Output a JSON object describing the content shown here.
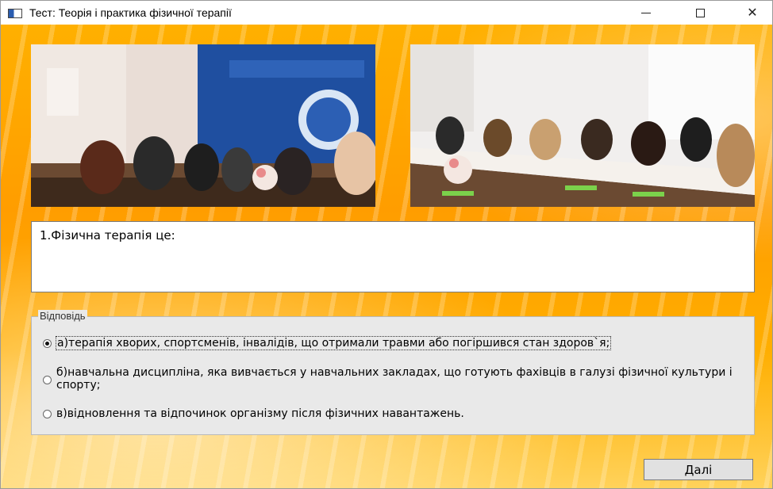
{
  "window": {
    "title": "Тест: Теорія і практика фізичної терапії",
    "minimize_glyph": "—",
    "maximize_glyph": "☐",
    "close_glyph": "✕"
  },
  "question": {
    "text": "1.Фізична терапія це:"
  },
  "answers": {
    "legend": "Відповідь",
    "options": [
      {
        "label": "а)терапія хворих, спортсменів, інвалідів, що отримали травми або погіршився стан здоров`я;",
        "selected": true
      },
      {
        "label": "б)навчальна дисципліна, яка вивчається у навчальних закладах, що готують фахівців в галузі фізичної культури і спорту;",
        "selected": false
      },
      {
        "label": "в)відновлення  та відпочинок організму після фізичних навантажень.",
        "selected": false
      }
    ]
  },
  "next_button": {
    "label": "Далі"
  },
  "colors": {
    "background": "#ffa800",
    "panel": "#e9e9e9"
  },
  "icons": [
    "app-icon",
    "minimize-icon",
    "maximize-icon",
    "close-icon"
  ]
}
